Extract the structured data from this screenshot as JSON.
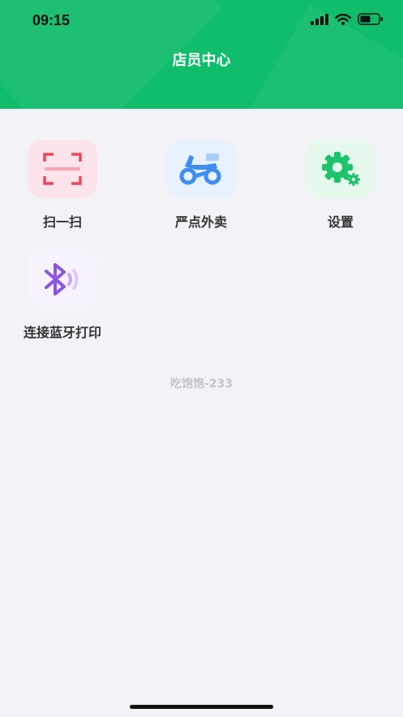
{
  "status_bar": {
    "time": "09:15"
  },
  "header": {
    "title": "店员中心"
  },
  "menu": [
    {
      "label": "扫一扫",
      "icon": "scan-icon",
      "bg": "#fde4ea",
      "color": "#f0445d"
    },
    {
      "label": "严点外卖",
      "icon": "scooter-icon",
      "bg": "#e7f1ff",
      "color": "#3e8df2"
    },
    {
      "label": "设置",
      "icon": "gear-icon",
      "bg": "#e5f8eb",
      "color": "#1cc36b"
    },
    {
      "label": "连接蓝牙打印",
      "icon": "bluetooth-icon",
      "bg": "#f7f3fc",
      "color": "#8a55e6"
    }
  ],
  "footer": {
    "store_name": "吃饱饱-233"
  },
  "colors": {
    "header": "#0fbd6a",
    "background": "#f3f2f7"
  }
}
